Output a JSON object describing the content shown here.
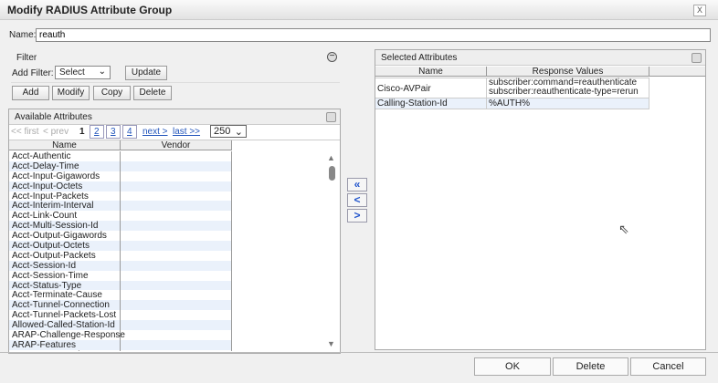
{
  "dialog": {
    "title": "Modify RADIUS Attribute Group",
    "close": "X"
  },
  "name": {
    "label": "Name:",
    "value": "reauth"
  },
  "filter": {
    "title": "Filter",
    "add_filter_label": "Add Filter:",
    "select_value": "Select",
    "update": "Update"
  },
  "actions": {
    "add": "Add",
    "modify": "Modify",
    "copy": "Copy",
    "delete": "Delete"
  },
  "available": {
    "title": "Available Attributes",
    "pager": {
      "first": "<< first",
      "prev": "< prev",
      "current": "1",
      "pages": [
        "2",
        "3",
        "4"
      ],
      "next": "next >",
      "last": "last >>",
      "page_size": "250"
    },
    "columns": [
      "Name",
      "Vendor"
    ],
    "rows": [
      "Acct-Authentic",
      "Acct-Delay-Time",
      "Acct-Input-Gigawords",
      "Acct-Input-Octets",
      "Acct-Input-Packets",
      "Acct-Interim-Interval",
      "Acct-Link-Count",
      "Acct-Multi-Session-Id",
      "Acct-Output-Gigawords",
      "Acct-Output-Octets",
      "Acct-Output-Packets",
      "Acct-Session-Id",
      "Acct-Session-Time",
      "Acct-Status-Type",
      "Acct-Terminate-Cause",
      "Acct-Tunnel-Connection",
      "Acct-Tunnel-Packets-Lost",
      "Allowed-Called-Station-Id",
      "ARAP-Challenge-Response",
      "ARAP-Features",
      "ARAP-Password"
    ]
  },
  "transfer": {
    "add_all": "«",
    "remove": "<",
    "add": ">"
  },
  "selected": {
    "title": "Selected Attributes",
    "columns": [
      "Name",
      "Response Values"
    ],
    "rows": [
      {
        "name": "Cisco-AVPair",
        "values": [
          "subscriber:command=reauthenticate",
          "subscriber:reauthenticate-type=rerun"
        ]
      },
      {
        "name": "Calling-Station-Id",
        "values": [
          "%AUTH%"
        ]
      }
    ]
  },
  "footer": {
    "ok": "OK",
    "delete": "Delete",
    "cancel": "Cancel"
  }
}
